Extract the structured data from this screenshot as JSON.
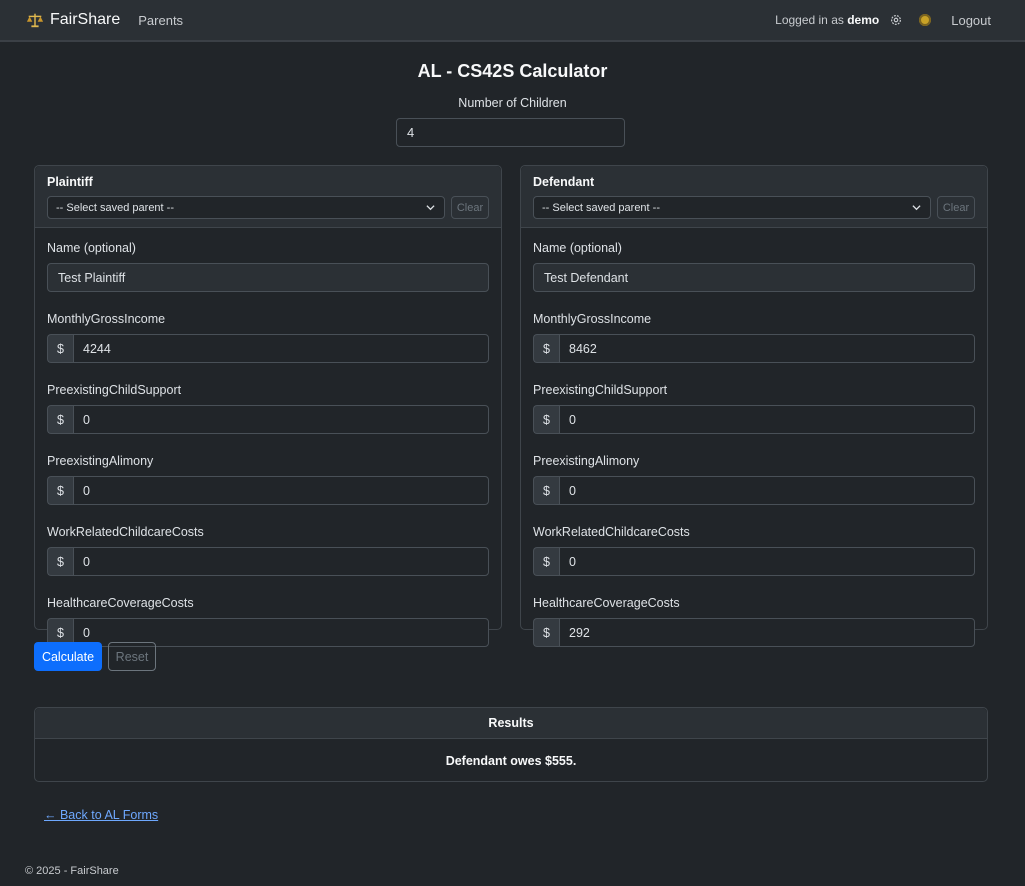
{
  "nav": {
    "brand": "FairShare",
    "parents_link": "Parents",
    "logged_in_prefix": "Logged in as",
    "username": "demo",
    "logout": "Logout"
  },
  "page": {
    "title": "AL - CS42S Calculator",
    "num_children_label": "Number of Children",
    "num_children_value": "4"
  },
  "select_placeholder": "-- Select saved parent --",
  "clear_label": "Clear",
  "labels": {
    "name": "Name (optional)",
    "income": "MonthlyGrossIncome",
    "child_support": "PreexistingChildSupport",
    "alimony": "PreexistingAlimony",
    "childcare": "WorkRelatedChildcareCosts",
    "healthcare": "HealthcareCoverageCosts",
    "currency": "$"
  },
  "plaintiff": {
    "title": "Plaintiff",
    "name": "Test Plaintiff",
    "income": "4244",
    "child_support": "0",
    "alimony": "0",
    "childcare": "0",
    "healthcare": "0"
  },
  "defendant": {
    "title": "Defendant",
    "name": "Test Defendant",
    "income": "8462",
    "child_support": "0",
    "alimony": "0",
    "childcare": "0",
    "healthcare": "292"
  },
  "buttons": {
    "calculate": "Calculate",
    "reset": "Reset"
  },
  "results": {
    "header": "Results",
    "text": "Defendant owes $555."
  },
  "back_link": "← Back to AL Forms",
  "footer": "© 2025 - FairShare",
  "colors": {
    "primary": "#0d6efd",
    "link": "#6ea8fe",
    "background": "#212529"
  }
}
